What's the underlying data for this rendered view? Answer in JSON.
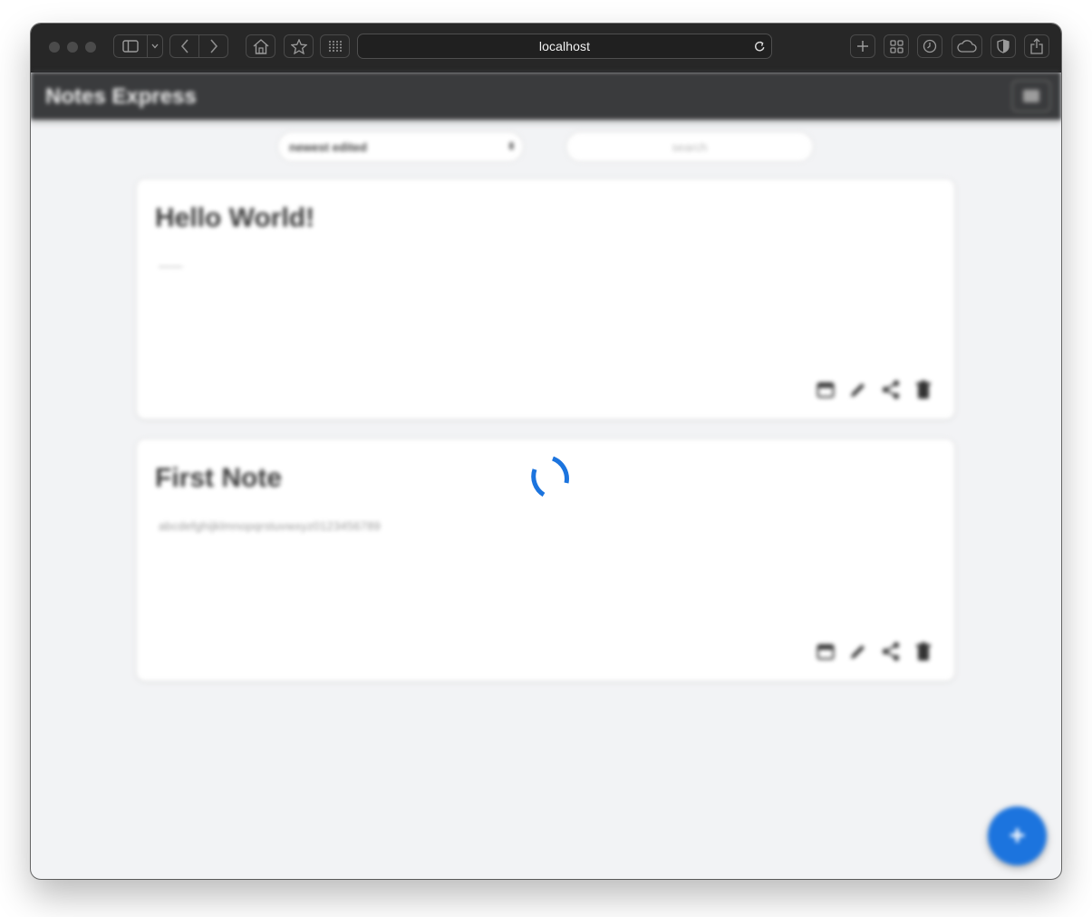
{
  "browser": {
    "address": "localhost",
    "icons": {
      "sidebar": "sidebar-icon",
      "sidebar_menu": "chevron-down-icon",
      "back": "chevron-left-icon",
      "forward": "chevron-right-icon",
      "home": "home-icon",
      "bookmark": "star-icon",
      "extensions": "grid-dots-icon",
      "reload": "reload-icon",
      "new_tab": "plus-icon",
      "tab_overview": "tab-overview-icon",
      "history": "clock-icon",
      "cloud": "cloud-icon",
      "privacy": "shield-icon",
      "share": "share-icon"
    }
  },
  "app": {
    "title": "Notes Express",
    "menu_icon": "menu-icon"
  },
  "toolbar": {
    "sort_value": "newest edited",
    "search_placeholder": "search"
  },
  "notes": [
    {
      "title": "Hello World!",
      "body": "——",
      "actions": [
        "calendar-icon",
        "pencil-icon",
        "share-icon",
        "trash-icon"
      ]
    },
    {
      "title": "First Note",
      "body": "abcdefghijklmnopqrstuvwxyz0123456789",
      "actions": [
        "calendar-icon",
        "pencil-icon",
        "share-icon",
        "trash-icon"
      ]
    }
  ],
  "add_button": {
    "label": "+"
  },
  "loading": true,
  "colors": {
    "accent": "#1c74de",
    "appbar": "#3a3b3d",
    "chrome": "#272727",
    "background": "#f2f3f5"
  }
}
